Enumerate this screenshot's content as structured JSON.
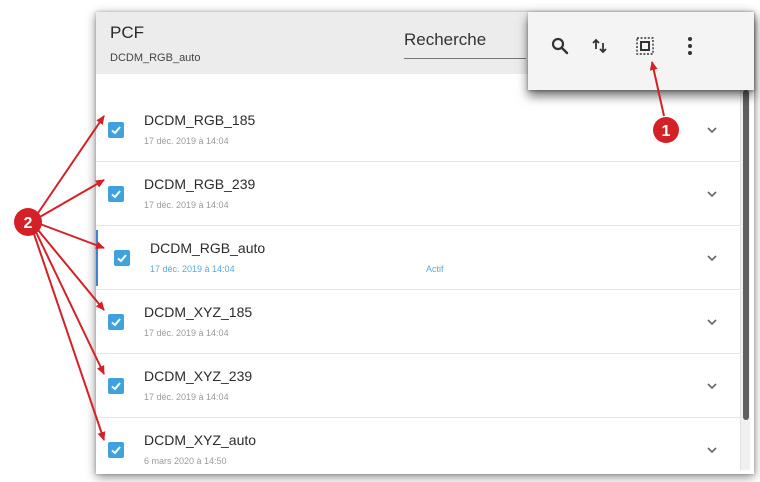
{
  "header": {
    "title": "PCF",
    "subtitle": "DCDM_RGB_auto",
    "search_label": "Recherche"
  },
  "toolbar": {
    "buttons": [
      {
        "name": "search-button",
        "icon": "search-icon"
      },
      {
        "name": "sort-button",
        "icon": "sort-icon"
      },
      {
        "name": "select-all-button",
        "icon": "select-all-icon"
      },
      {
        "name": "more-options-button",
        "icon": "more-vertical-icon"
      }
    ]
  },
  "list": {
    "items": [
      {
        "name": "DCDM_RGB_185",
        "date": "17 déc. 2019 à 14:04",
        "checked": true,
        "active": false,
        "status": ""
      },
      {
        "name": "DCDM_RGB_239",
        "date": "17 déc. 2019 à 14:04",
        "checked": true,
        "active": false,
        "status": ""
      },
      {
        "name": "DCDM_RGB_auto",
        "date": "17 déc. 2019 à 14:04",
        "checked": true,
        "active": true,
        "status": "Actif"
      },
      {
        "name": "DCDM_XYZ_185",
        "date": "17 déc. 2019 à 14:04",
        "checked": true,
        "active": false,
        "status": ""
      },
      {
        "name": "DCDM_XYZ_239",
        "date": "17 déc. 2019 à 14:04",
        "checked": true,
        "active": false,
        "status": ""
      },
      {
        "name": "DCDM_XYZ_auto",
        "date": "6 mars 2020 à 14:50",
        "checked": true,
        "active": false,
        "status": ""
      }
    ]
  },
  "annotations": {
    "callout_1": "1",
    "callout_2": "2",
    "color": "#d42027"
  },
  "colors": {
    "checkbox": "#3ea2dd",
    "active_text": "#57a8dc",
    "active_bar": "#3f7fd6",
    "header_bg": "#ececec"
  }
}
